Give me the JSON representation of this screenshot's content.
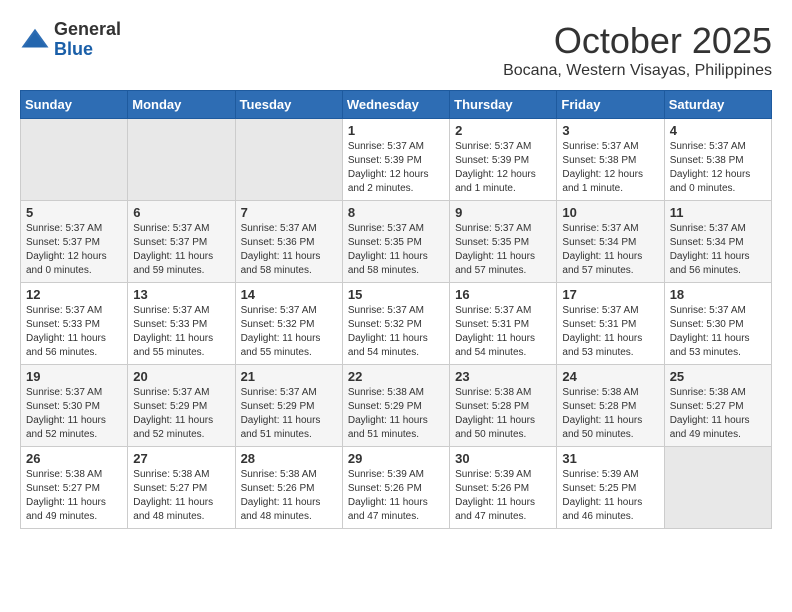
{
  "header": {
    "logo_general": "General",
    "logo_blue": "Blue",
    "month_title": "October 2025",
    "location": "Bocana, Western Visayas, Philippines"
  },
  "weekdays": [
    "Sunday",
    "Monday",
    "Tuesday",
    "Wednesday",
    "Thursday",
    "Friday",
    "Saturday"
  ],
  "weeks": [
    [
      {
        "day": "",
        "info": ""
      },
      {
        "day": "",
        "info": ""
      },
      {
        "day": "",
        "info": ""
      },
      {
        "day": "1",
        "info": "Sunrise: 5:37 AM\nSunset: 5:39 PM\nDaylight: 12 hours\nand 2 minutes."
      },
      {
        "day": "2",
        "info": "Sunrise: 5:37 AM\nSunset: 5:39 PM\nDaylight: 12 hours\nand 1 minute."
      },
      {
        "day": "3",
        "info": "Sunrise: 5:37 AM\nSunset: 5:38 PM\nDaylight: 12 hours\nand 1 minute."
      },
      {
        "day": "4",
        "info": "Sunrise: 5:37 AM\nSunset: 5:38 PM\nDaylight: 12 hours\nand 0 minutes."
      }
    ],
    [
      {
        "day": "5",
        "info": "Sunrise: 5:37 AM\nSunset: 5:37 PM\nDaylight: 12 hours\nand 0 minutes."
      },
      {
        "day": "6",
        "info": "Sunrise: 5:37 AM\nSunset: 5:37 PM\nDaylight: 11 hours\nand 59 minutes."
      },
      {
        "day": "7",
        "info": "Sunrise: 5:37 AM\nSunset: 5:36 PM\nDaylight: 11 hours\nand 58 minutes."
      },
      {
        "day": "8",
        "info": "Sunrise: 5:37 AM\nSunset: 5:35 PM\nDaylight: 11 hours\nand 58 minutes."
      },
      {
        "day": "9",
        "info": "Sunrise: 5:37 AM\nSunset: 5:35 PM\nDaylight: 11 hours\nand 57 minutes."
      },
      {
        "day": "10",
        "info": "Sunrise: 5:37 AM\nSunset: 5:34 PM\nDaylight: 11 hours\nand 57 minutes."
      },
      {
        "day": "11",
        "info": "Sunrise: 5:37 AM\nSunset: 5:34 PM\nDaylight: 11 hours\nand 56 minutes."
      }
    ],
    [
      {
        "day": "12",
        "info": "Sunrise: 5:37 AM\nSunset: 5:33 PM\nDaylight: 11 hours\nand 56 minutes."
      },
      {
        "day": "13",
        "info": "Sunrise: 5:37 AM\nSunset: 5:33 PM\nDaylight: 11 hours\nand 55 minutes."
      },
      {
        "day": "14",
        "info": "Sunrise: 5:37 AM\nSunset: 5:32 PM\nDaylight: 11 hours\nand 55 minutes."
      },
      {
        "day": "15",
        "info": "Sunrise: 5:37 AM\nSunset: 5:32 PM\nDaylight: 11 hours\nand 54 minutes."
      },
      {
        "day": "16",
        "info": "Sunrise: 5:37 AM\nSunset: 5:31 PM\nDaylight: 11 hours\nand 54 minutes."
      },
      {
        "day": "17",
        "info": "Sunrise: 5:37 AM\nSunset: 5:31 PM\nDaylight: 11 hours\nand 53 minutes."
      },
      {
        "day": "18",
        "info": "Sunrise: 5:37 AM\nSunset: 5:30 PM\nDaylight: 11 hours\nand 53 minutes."
      }
    ],
    [
      {
        "day": "19",
        "info": "Sunrise: 5:37 AM\nSunset: 5:30 PM\nDaylight: 11 hours\nand 52 minutes."
      },
      {
        "day": "20",
        "info": "Sunrise: 5:37 AM\nSunset: 5:29 PM\nDaylight: 11 hours\nand 52 minutes."
      },
      {
        "day": "21",
        "info": "Sunrise: 5:37 AM\nSunset: 5:29 PM\nDaylight: 11 hours\nand 51 minutes."
      },
      {
        "day": "22",
        "info": "Sunrise: 5:38 AM\nSunset: 5:29 PM\nDaylight: 11 hours\nand 51 minutes."
      },
      {
        "day": "23",
        "info": "Sunrise: 5:38 AM\nSunset: 5:28 PM\nDaylight: 11 hours\nand 50 minutes."
      },
      {
        "day": "24",
        "info": "Sunrise: 5:38 AM\nSunset: 5:28 PM\nDaylight: 11 hours\nand 50 minutes."
      },
      {
        "day": "25",
        "info": "Sunrise: 5:38 AM\nSunset: 5:27 PM\nDaylight: 11 hours\nand 49 minutes."
      }
    ],
    [
      {
        "day": "26",
        "info": "Sunrise: 5:38 AM\nSunset: 5:27 PM\nDaylight: 11 hours\nand 49 minutes."
      },
      {
        "day": "27",
        "info": "Sunrise: 5:38 AM\nSunset: 5:27 PM\nDaylight: 11 hours\nand 48 minutes."
      },
      {
        "day": "28",
        "info": "Sunrise: 5:38 AM\nSunset: 5:26 PM\nDaylight: 11 hours\nand 48 minutes."
      },
      {
        "day": "29",
        "info": "Sunrise: 5:39 AM\nSunset: 5:26 PM\nDaylight: 11 hours\nand 47 minutes."
      },
      {
        "day": "30",
        "info": "Sunrise: 5:39 AM\nSunset: 5:26 PM\nDaylight: 11 hours\nand 47 minutes."
      },
      {
        "day": "31",
        "info": "Sunrise: 5:39 AM\nSunset: 5:25 PM\nDaylight: 11 hours\nand 46 minutes."
      },
      {
        "day": "",
        "info": ""
      }
    ]
  ]
}
